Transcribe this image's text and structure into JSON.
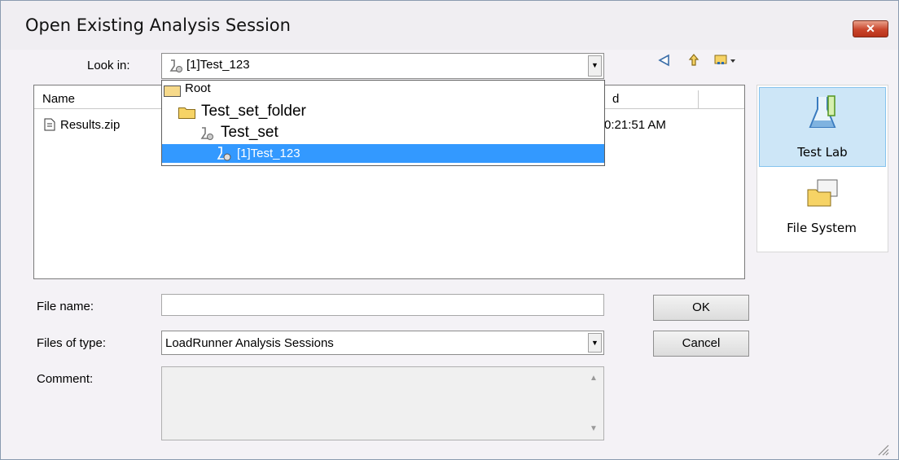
{
  "window": {
    "title": "Open Existing Analysis Session",
    "close_label": "✕"
  },
  "look_in": {
    "label": "Look in:",
    "value": "[1]Test_123"
  },
  "dropdown_items": [
    {
      "label": "Root",
      "icon": "folder-icon"
    },
    {
      "label": "Test_set_folder",
      "icon": "folder-icon"
    },
    {
      "label": "Test_set",
      "icon": "test-set-icon"
    },
    {
      "label": "[1]Test_123",
      "icon": "test-icon",
      "selected": true
    }
  ],
  "file_list": {
    "columns": [
      "Name",
      "d"
    ],
    "rows": [
      {
        "name": "Results.zip",
        "modified": "0:21:51 AM"
      }
    ]
  },
  "sidebar": {
    "items": [
      {
        "label": "Test Lab",
        "icon": "flask-icon",
        "selected": true
      },
      {
        "label": "File System",
        "icon": "file-system-icon",
        "selected": false
      }
    ]
  },
  "form": {
    "file_name_label": "File name:",
    "file_name_value": "",
    "files_of_type_label": "Files of type:",
    "files_of_type_value": "LoadRunner Analysis Sessions",
    "comment_label": "Comment:",
    "comment_value": ""
  },
  "buttons": {
    "ok": "OK",
    "cancel": "Cancel"
  },
  "colors": {
    "selection": "#3399ff",
    "sidebar_selected": "#cde6f7",
    "close_button": "#c9452b"
  }
}
